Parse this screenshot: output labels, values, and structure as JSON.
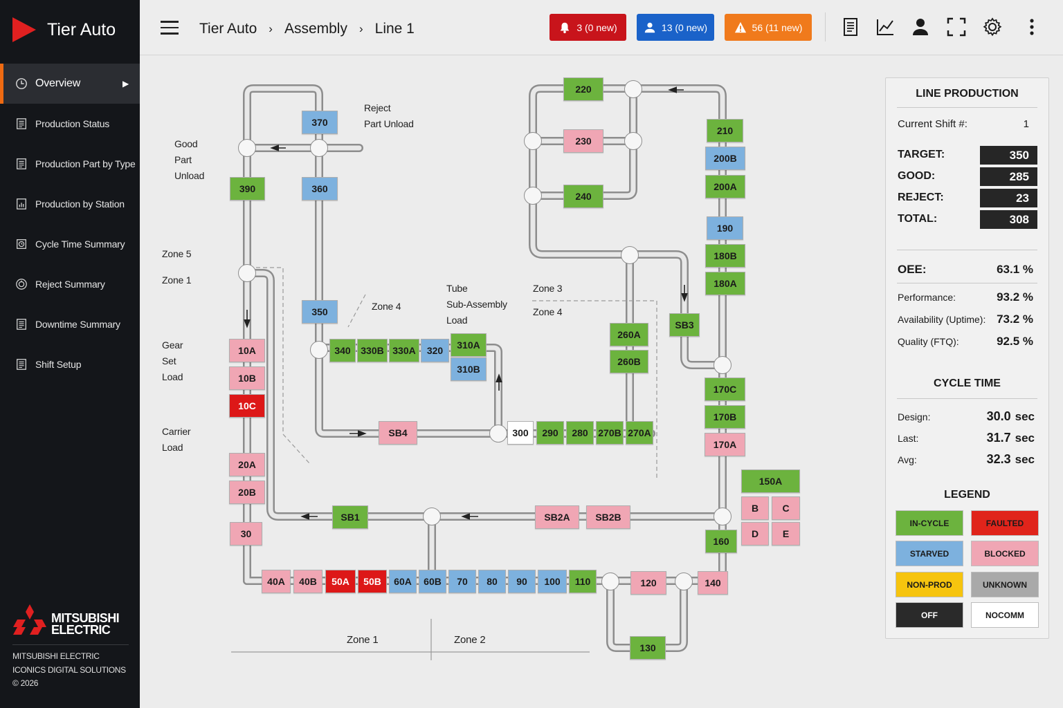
{
  "app": {
    "name": "Tier Auto"
  },
  "sidebar": {
    "items": [
      {
        "label": "Overview",
        "icon": "clock-icon",
        "active": true
      },
      {
        "label": "Production Status",
        "icon": "report-icon"
      },
      {
        "label": "Production Part by Type",
        "icon": "report-icon"
      },
      {
        "label": "Production by Station",
        "icon": "chart-doc-icon"
      },
      {
        "label": "Cycle Time Summary",
        "icon": "cycle-icon"
      },
      {
        "label": "Reject Summary",
        "icon": "reject-icon"
      },
      {
        "label": "Downtime Summary",
        "icon": "report-icon"
      },
      {
        "label": "Shift Setup",
        "icon": "report-icon"
      }
    ],
    "vendor_logo": "MITSUBISHI ELECTRIC",
    "credits": [
      "MITSUBISHI ELECTRIC",
      "ICONICS DIGITAL SOLUTIONS",
      "© 2026"
    ]
  },
  "header": {
    "breadcrumb": [
      "Tier Auto",
      "Assembly",
      "Line 1"
    ],
    "alerts": {
      "alarms": "3 (0 new)",
      "users": "13 (0 new)",
      "warnings": "56 (11 new)"
    },
    "alert_colors": {
      "alarms": "#c8141b",
      "users": "#1a62c9",
      "warnings": "#f07a1c"
    },
    "icons": [
      "report-icon",
      "trend-icon",
      "user-icon",
      "fullscreen-icon",
      "settings-gear-icon",
      "more-vertical-icon"
    ]
  },
  "diagram": {
    "labels": {
      "good_unload": [
        "Good",
        "Part",
        "Unload"
      ],
      "reject_unload": [
        "Reject",
        "Part Unload"
      ],
      "zone5": "Zone 5",
      "zone1_left": "Zone 1",
      "zone4_center": "Zone 4",
      "tube_load": [
        "Tube",
        "Sub-Assembly",
        "Load"
      ],
      "zone3": "Zone 3",
      "zone4_right": "Zone 4",
      "gear_load": [
        "Gear",
        "Set",
        "Load"
      ],
      "carrier_load": [
        "Carrier",
        "Load"
      ],
      "zone1_bottom": "Zone 1",
      "zone2_bottom": "Zone 2"
    },
    "stations": [
      {
        "id": "370",
        "status": "starved"
      },
      {
        "id": "390",
        "status": "in-cycle"
      },
      {
        "id": "360",
        "status": "starved"
      },
      {
        "id": "350",
        "status": "starved"
      },
      {
        "id": "10A",
        "status": "blocked"
      },
      {
        "id": "10B",
        "status": "blocked"
      },
      {
        "id": "10C",
        "status": "faulted"
      },
      {
        "id": "20A",
        "status": "blocked"
      },
      {
        "id": "20B",
        "status": "blocked"
      },
      {
        "id": "30",
        "status": "blocked"
      },
      {
        "id": "340",
        "status": "in-cycle"
      },
      {
        "id": "330B",
        "status": "in-cycle"
      },
      {
        "id": "330A",
        "status": "in-cycle"
      },
      {
        "id": "320",
        "status": "starved"
      },
      {
        "id": "310A",
        "status": "in-cycle"
      },
      {
        "id": "310B",
        "status": "starved"
      },
      {
        "id": "SB4",
        "status": "blocked"
      },
      {
        "id": "300",
        "status": "off"
      },
      {
        "id": "290",
        "status": "in-cycle"
      },
      {
        "id": "280",
        "status": "in-cycle"
      },
      {
        "id": "270B",
        "status": "in-cycle"
      },
      {
        "id": "270A",
        "status": "in-cycle"
      },
      {
        "id": "220",
        "status": "in-cycle"
      },
      {
        "id": "230",
        "status": "blocked"
      },
      {
        "id": "240",
        "status": "in-cycle"
      },
      {
        "id": "210",
        "status": "in-cycle"
      },
      {
        "id": "200B",
        "status": "starved"
      },
      {
        "id": "200A",
        "status": "in-cycle"
      },
      {
        "id": "190",
        "status": "starved"
      },
      {
        "id": "180B",
        "status": "in-cycle"
      },
      {
        "id": "180A",
        "status": "in-cycle"
      },
      {
        "id": "SB3",
        "status": "in-cycle"
      },
      {
        "id": "260A",
        "status": "in-cycle"
      },
      {
        "id": "260B",
        "status": "in-cycle"
      },
      {
        "id": "170C",
        "status": "in-cycle"
      },
      {
        "id": "170B",
        "status": "in-cycle"
      },
      {
        "id": "170A",
        "status": "blocked"
      },
      {
        "id": "150A",
        "status": "in-cycle"
      },
      {
        "id": "B",
        "status": "blocked"
      },
      {
        "id": "C",
        "status": "blocked"
      },
      {
        "id": "D",
        "status": "blocked"
      },
      {
        "id": "E",
        "status": "blocked"
      },
      {
        "id": "SB1",
        "status": "in-cycle"
      },
      {
        "id": "SB2A",
        "status": "blocked"
      },
      {
        "id": "SB2B",
        "status": "blocked"
      },
      {
        "id": "160",
        "status": "in-cycle"
      },
      {
        "id": "40A",
        "status": "blocked"
      },
      {
        "id": "40B",
        "status": "blocked"
      },
      {
        "id": "50A",
        "status": "faulted"
      },
      {
        "id": "50B",
        "status": "faulted"
      },
      {
        "id": "60A",
        "status": "starved"
      },
      {
        "id": "60B",
        "status": "starved"
      },
      {
        "id": "70",
        "status": "starved"
      },
      {
        "id": "80",
        "status": "starved"
      },
      {
        "id": "90",
        "status": "starved"
      },
      {
        "id": "100",
        "status": "starved"
      },
      {
        "id": "110",
        "status": "in-cycle"
      },
      {
        "id": "120",
        "status": "blocked"
      },
      {
        "id": "140",
        "status": "blocked"
      },
      {
        "id": "130",
        "status": "in-cycle"
      }
    ]
  },
  "panel": {
    "title": "LINE PRODUCTION",
    "shift_label": "Current Shift #:",
    "shift_value": "1",
    "kpis": [
      {
        "label": "TARGET:",
        "value": "350"
      },
      {
        "label": "GOOD:",
        "value": "285"
      },
      {
        "label": "REJECT:",
        "value": "23"
      },
      {
        "label": "TOTAL:",
        "value": "308"
      }
    ],
    "oee_label": "OEE:",
    "oee_value": "63.1 %",
    "metrics": [
      {
        "label": "Performance:",
        "value": "93.2 %"
      },
      {
        "label": "Availability (Uptime):",
        "value": "73.2 %"
      },
      {
        "label": "Quality (FTQ):",
        "value": "92.5 %"
      }
    ],
    "cycle_title": "CYCLE TIME",
    "cycle": [
      {
        "label": "Design:",
        "value": "30.0",
        "unit": "sec"
      },
      {
        "label": "Last:",
        "value": "31.7",
        "unit": "sec"
      },
      {
        "label": "Avg:",
        "value": "32.3",
        "unit": "sec"
      }
    ],
    "legend_title": "LEGEND",
    "legend": [
      {
        "label": "IN-CYCLE",
        "color": "#6cb33e"
      },
      {
        "label": "FAULTED",
        "color": "#e0241b"
      },
      {
        "label": "STARVED",
        "color": "#7db1de"
      },
      {
        "label": "BLOCKED",
        "color": "#f0a6b4"
      },
      {
        "label": "NON-PROD",
        "color": "#f6c40e"
      },
      {
        "label": "UNKNOWN",
        "color": "#a9a9a9"
      },
      {
        "label": "OFF",
        "color": "#2a2a2a"
      },
      {
        "label": "NOCOMM",
        "color": "#ffffff"
      }
    ]
  }
}
